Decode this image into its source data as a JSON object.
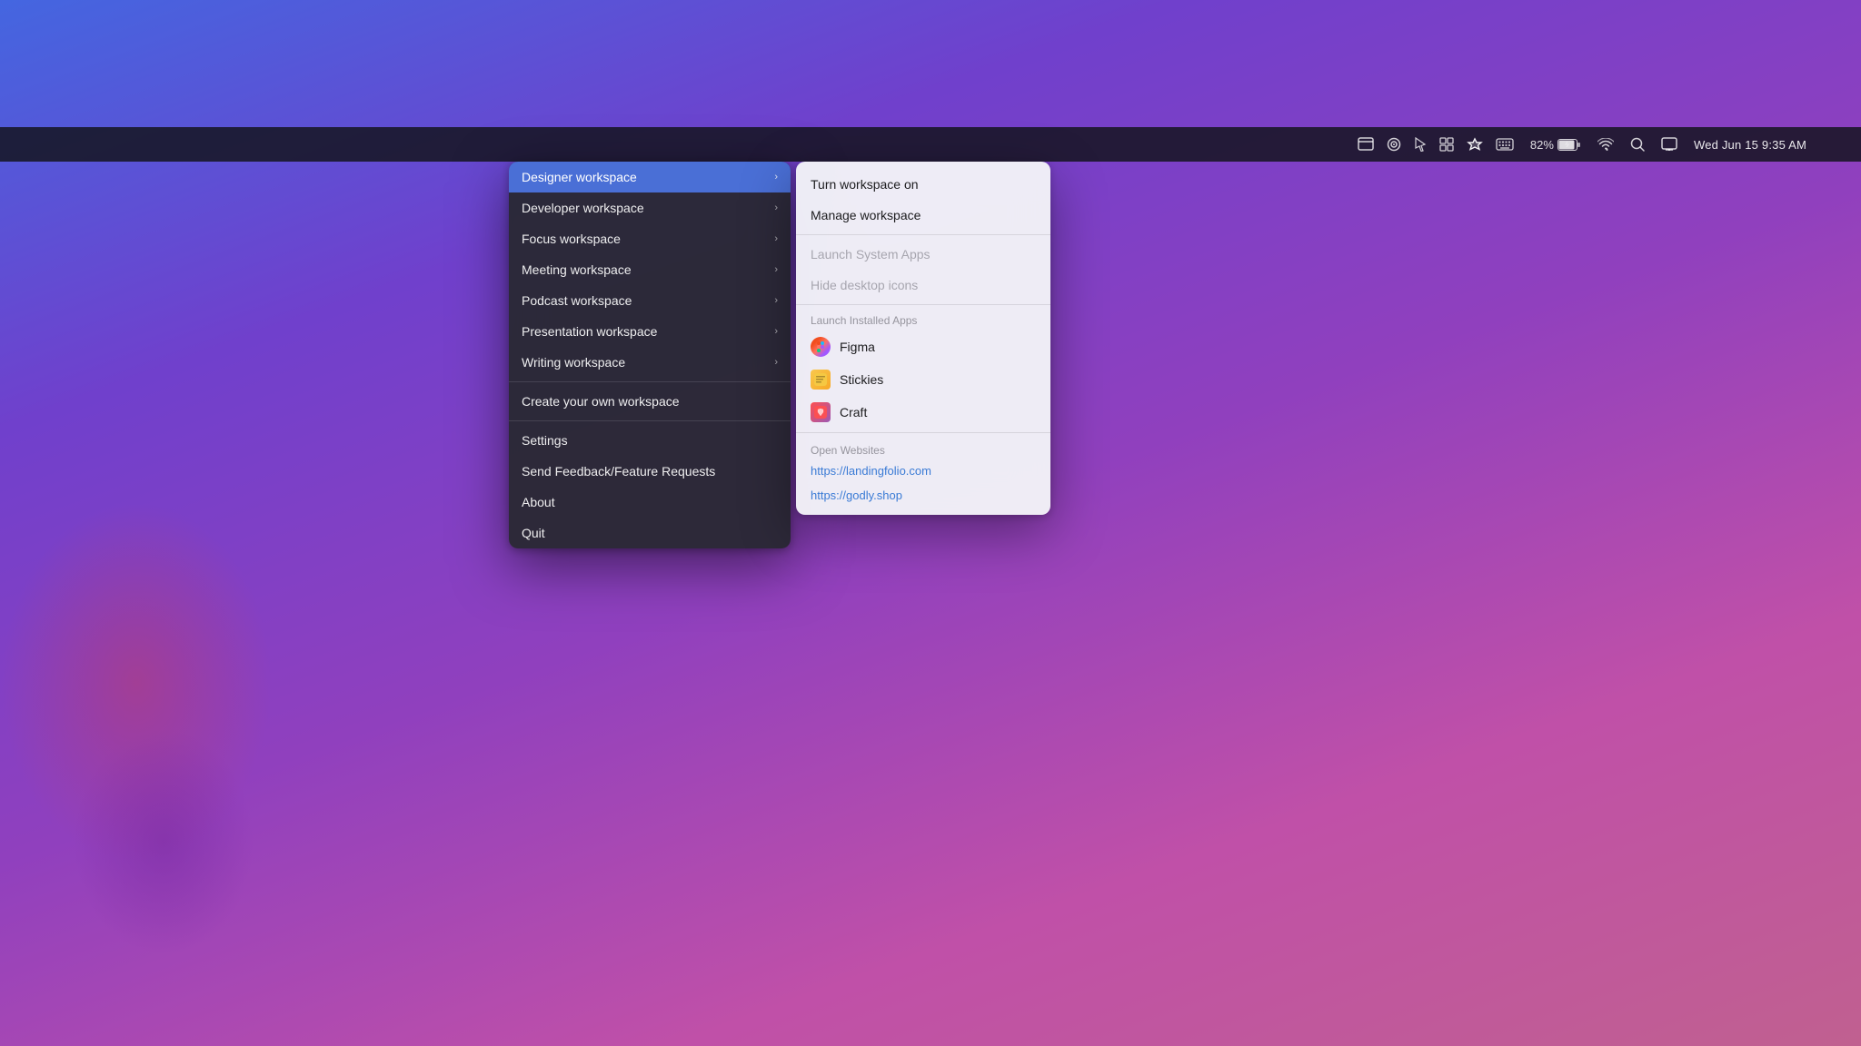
{
  "desktop": {
    "background": "macOS Monterey purple gradient"
  },
  "menubar": {
    "battery_percent": "82%",
    "datetime": "Wed Jun 15  9:35 AM",
    "icons": [
      "finder",
      "target",
      "cursor",
      "grid",
      "cursor-click",
      "keyboard",
      "battery",
      "wifi",
      "search",
      "display"
    ]
  },
  "primary_menu": {
    "items": [
      {
        "label": "Designer workspace",
        "has_submenu": true,
        "active": true
      },
      {
        "label": "Developer workspace",
        "has_submenu": true,
        "active": false
      },
      {
        "label": "Focus workspace",
        "has_submenu": true,
        "active": false
      },
      {
        "label": "Meeting workspace",
        "has_submenu": true,
        "active": false
      },
      {
        "label": "Podcast workspace",
        "has_submenu": true,
        "active": false
      },
      {
        "label": "Presentation workspace",
        "has_submenu": true,
        "active": false
      },
      {
        "label": "Writing workspace",
        "has_submenu": true,
        "active": false
      }
    ],
    "create_item": "Create your own workspace",
    "bottom_items": [
      "Settings",
      "Send Feedback/Feature Requests",
      "About",
      "Quit"
    ]
  },
  "submenu": {
    "turn_on_label": "Turn workspace on",
    "manage_label": "Manage workspace",
    "system_section_label": "Launch System Apps",
    "system_items": [
      "Launch System Apps",
      "Hide desktop icons"
    ],
    "installed_section_label": "Launch Installed Apps",
    "installed_apps": [
      {
        "name": "Figma",
        "icon_type": "figma"
      },
      {
        "name": "Stickies",
        "icon_type": "stickies"
      },
      {
        "name": "Craft",
        "icon_type": "craft"
      }
    ],
    "websites_label": "Open Websites",
    "websites": [
      "https://landingfolio.com",
      "https://godly.shop"
    ]
  }
}
